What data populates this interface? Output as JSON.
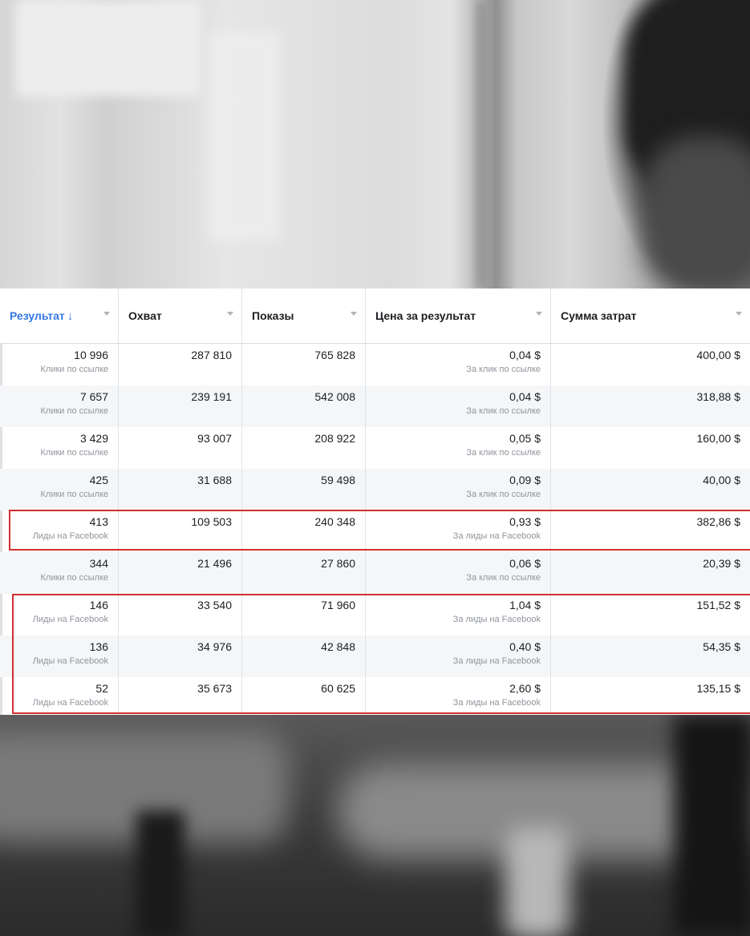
{
  "columns": [
    {
      "label": "Результат",
      "sorted": true,
      "sort_arrow": "↓"
    },
    {
      "label": "Охват"
    },
    {
      "label": "Показы"
    },
    {
      "label": "Цена за результат"
    },
    {
      "label": "Сумма затрат"
    }
  ],
  "rows": [
    {
      "result": "10 996",
      "result_type": "Клики по ссылке",
      "reach": "287 810",
      "impressions": "765 828",
      "cost_per_result": "0,04 $",
      "cost_type": "За клик по ссылке",
      "spend": "400,00 $"
    },
    {
      "result": "7 657",
      "result_type": "Клики по ссылке",
      "reach": "239 191",
      "impressions": "542 008",
      "cost_per_result": "0,04 $",
      "cost_type": "За клик по ссылке",
      "spend": "318,88 $"
    },
    {
      "result": "3 429",
      "result_type": "Клики по ссылке",
      "reach": "93 007",
      "impressions": "208 922",
      "cost_per_result": "0,05 $",
      "cost_type": "За клик по ссылке",
      "spend": "160,00 $"
    },
    {
      "result": "425",
      "result_type": "Клики по ссылке",
      "reach": "31 688",
      "impressions": "59 498",
      "cost_per_result": "0,09 $",
      "cost_type": "За клик по ссылке",
      "spend": "40,00 $"
    },
    {
      "result": "413",
      "result_type": "Лиды на Facebook",
      "reach": "109 503",
      "impressions": "240 348",
      "cost_per_result": "0,93 $",
      "cost_type": "За лиды на Facebook",
      "spend": "382,86 $"
    },
    {
      "result": "344",
      "result_type": "Клики по ссылке",
      "reach": "21 496",
      "impressions": "27 860",
      "cost_per_result": "0,06 $",
      "cost_type": "За клик по ссылке",
      "spend": "20,39 $"
    },
    {
      "result": "146",
      "result_type": "Лиды на Facebook",
      "reach": "33 540",
      "impressions": "71 960",
      "cost_per_result": "1,04 $",
      "cost_type": "За лиды на Facebook",
      "spend": "151,52 $"
    },
    {
      "result": "136",
      "result_type": "Лиды на Facebook",
      "reach": "34 976",
      "impressions": "42 848",
      "cost_per_result": "0,40 $",
      "cost_type": "За лиды на Facebook",
      "spend": "54,35 $"
    },
    {
      "result": "52",
      "result_type": "Лиды на Facebook",
      "reach": "35 673",
      "impressions": "60 625",
      "cost_per_result": "2,60 $",
      "cost_type": "За лиды на Facebook",
      "spend": "135,15 $"
    }
  ],
  "highlight_color": "#d32f2f",
  "accent_color": "#3578e5"
}
